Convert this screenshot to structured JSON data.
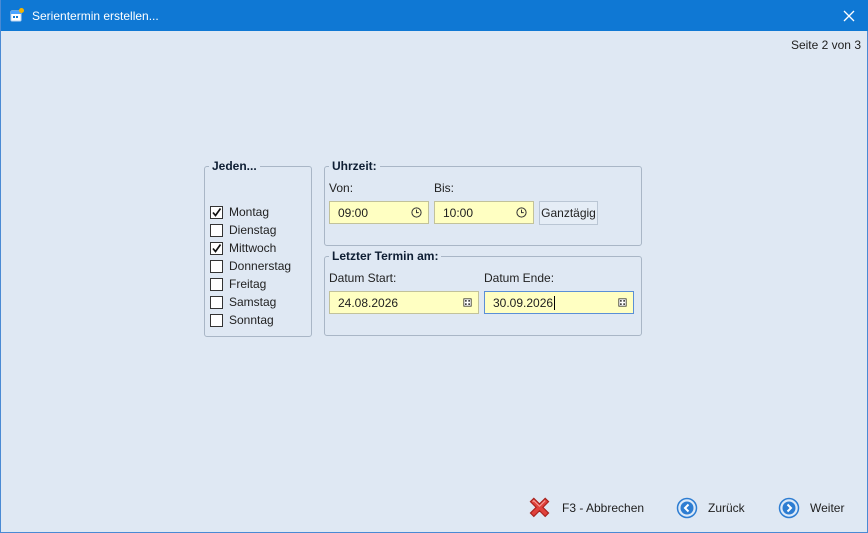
{
  "window": {
    "title": "Serientermin erstellen..."
  },
  "page_indicator": "Seite 2 von 3",
  "weekdays_group": {
    "legend": "Jeden...",
    "days": [
      {
        "label": "Montag",
        "checked": true
      },
      {
        "label": "Dienstag",
        "checked": false
      },
      {
        "label": "Mittwoch",
        "checked": true
      },
      {
        "label": "Donnerstag",
        "checked": false
      },
      {
        "label": "Freitag",
        "checked": false
      },
      {
        "label": "Samstag",
        "checked": false
      },
      {
        "label": "Sonntag",
        "checked": false
      }
    ]
  },
  "time_group": {
    "legend": "Uhrzeit:",
    "from_label": "Von:",
    "from_value": "09:00",
    "to_label": "Bis:",
    "to_value": "10:00",
    "allday_button": "Ganztägig"
  },
  "date_group": {
    "legend": "Letzter Termin am:",
    "start_label": "Datum Start:",
    "start_value": "24.08.2026",
    "end_label": "Datum Ende:",
    "end_value": "30.09.2026"
  },
  "footer": {
    "cancel_label": "F3 - Abbrechen",
    "back_label": "Zurück",
    "next_label": "Weiter"
  },
  "colors": {
    "titlebar": "#0f78d4",
    "background": "#dfe8f3",
    "field_bg": "#ffffc2",
    "cancel_red": "#d9322e",
    "nav_blue": "#2d7dd2"
  },
  "icons": [
    "app-icon",
    "close-icon",
    "clock-icon",
    "calendar-icon",
    "cancel-x-icon",
    "arrow-left-icon",
    "arrow-right-icon"
  ]
}
